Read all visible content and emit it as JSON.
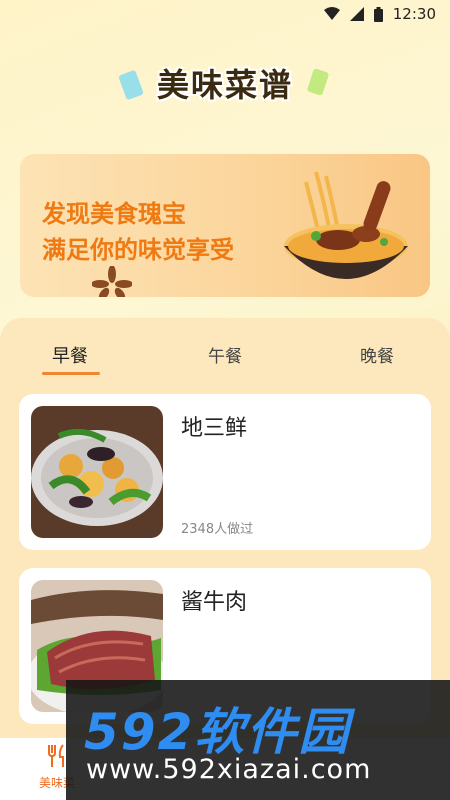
{
  "status_bar": {
    "time": "12:30"
  },
  "app": {
    "title": "美味菜谱"
  },
  "banner": {
    "line1": "发现美食瑰宝",
    "line2": "满足你的味觉享受"
  },
  "tabs": [
    {
      "label": "早餐",
      "active": true
    },
    {
      "label": "午餐",
      "active": false
    },
    {
      "label": "晚餐",
      "active": false
    }
  ],
  "recipes": [
    {
      "name": "地三鲜",
      "made_count": "2348人做过"
    },
    {
      "name": "酱牛肉",
      "made_count": ""
    }
  ],
  "bottom_nav": [
    {
      "label": "美味菜",
      "icon": "fork-knife-icon",
      "active": true
    }
  ],
  "watermark": {
    "brand": "592软件园",
    "url": "www.592xiazai.com"
  },
  "colors": {
    "accent": "#ef7a12",
    "panel": "#fde8bd",
    "tab_underline": "#f0872e",
    "watermark_blue": "#2f8cf0"
  }
}
